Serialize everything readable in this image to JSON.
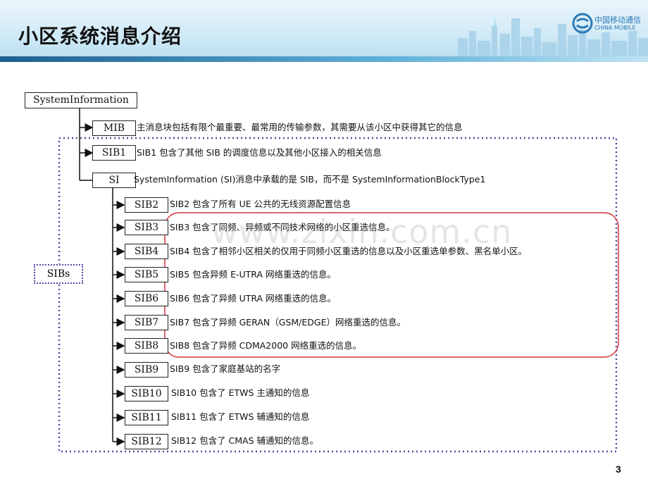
{
  "slide": {
    "title": "小区系统消息介绍",
    "page_number": "3",
    "watermark": "www.zixin.com.cn",
    "logo": {
      "line1": "中国移动通信",
      "line2": "CHINA MOBILE"
    }
  },
  "diagram": {
    "root_label": "SystemInformation",
    "sibs_label": "SIBs",
    "items": [
      {
        "label": "MIB",
        "desc": "主消息块包括有限个最重要、最常用的传输参数，其需要从该小区中获得其它的信息"
      },
      {
        "label": "SIB1",
        "desc": "SIB1 包含了其他 SIB 的调度信息以及其他小区接入的相关信息"
      },
      {
        "label": "SI",
        "desc": "SystemInformation (SI)消息中承载的是 SIB，而不是 SystemInformationBlockType1"
      },
      {
        "label": "SIB2",
        "desc": "SIB2 包含了所有 UE 公共的无线资源配置信息"
      },
      {
        "label": "SIB3",
        "desc": "SIB3 包含了同频、异频或不同技术网络的小区重选信息。"
      },
      {
        "label": "SIB4",
        "desc": "SIB4 包含了相邻小区相关的仅用于同频小区重选的信息以及小区重选单参数、黑名单小区。"
      },
      {
        "label": "SIB5",
        "desc": "SIB5 包含异频 E-UTRA 网络重选的信息。"
      },
      {
        "label": "SIB6",
        "desc": "SIB6 包含了异频 UTRA 网络重选的信息。"
      },
      {
        "label": "SIB7",
        "desc": "SIB7 包含了异频 GERAN（GSM/EDGE）网络重选的信息。"
      },
      {
        "label": "SIB8",
        "desc": "SIB8 包含了异频 CDMA2000 网络重选的信息。"
      },
      {
        "label": "SIB9",
        "desc": "SIB9 包含了家庭基站的名字"
      },
      {
        "label": "SIB10",
        "desc": "SIB10 包含了 ETWS 主通知的信息"
      },
      {
        "label": "SIB11",
        "desc": "SIB11 包含了 ETWS 辅通知的信息"
      },
      {
        "label": "SIB12",
        "desc": "SIB12 包含了 CMAS 辅通知的信息。"
      }
    ]
  },
  "colors": {
    "dotted_border": "#4a4aa8",
    "highlight_border": "#d0343a",
    "header_bg": "#d3ebf7",
    "logo": "#2c79b6"
  }
}
